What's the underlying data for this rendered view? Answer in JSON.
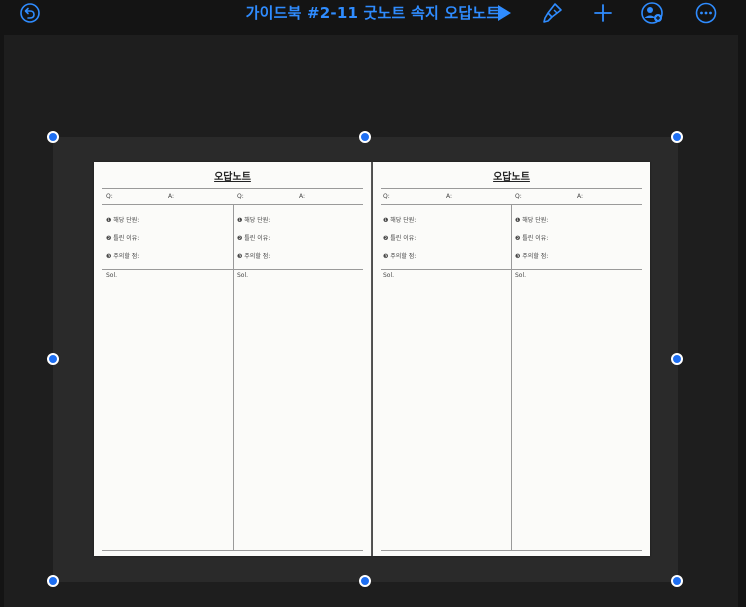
{
  "app": {
    "title": "가이드북 #2-11 굿노트 속지 오답노트"
  },
  "toolbar": {
    "undo_icon": "undo-icon",
    "play_icon": "play-icon",
    "brush_icon": "brush-icon",
    "add_icon": "add-icon",
    "collab_icon": "collaborate-icon",
    "more_icon": "more-icon",
    "accent_color": "#2f8cff"
  },
  "pages": [
    {
      "title": "오답노트",
      "q_label": "Q:",
      "a_label": "A:",
      "item1": "❶ 해당 단원:",
      "item2": "❷ 틀린 이유:",
      "item3": "❸ 주의할 점:",
      "sol_label": "Sol."
    },
    {
      "title": "오답노트",
      "q_label": "Q:",
      "a_label": "A:",
      "item1": "❶ 해당 단원:",
      "item2": "❷ 틀린 이유:",
      "item3": "❸ 주의할 점:",
      "sol_label": "Sol."
    }
  ]
}
